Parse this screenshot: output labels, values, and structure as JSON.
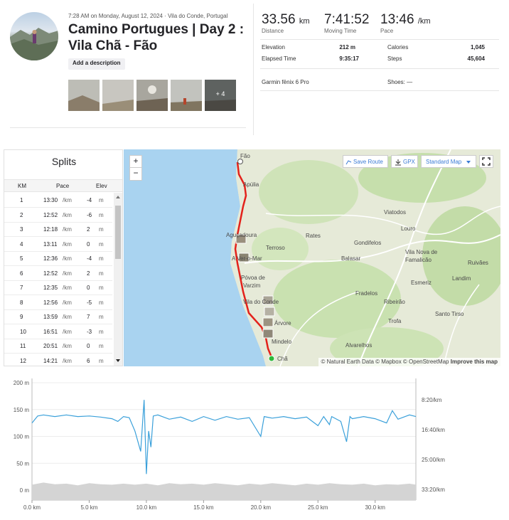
{
  "activity": {
    "meta": "7:28 AM on Monday, August 12, 2024 · Vila do Conde, Portugal",
    "title": "Camino Portugues | Day 2 : Vila Chã - Fão",
    "add_description": "Add a description",
    "more_photos": "+ 4"
  },
  "stats": {
    "distance": {
      "value": "33.56",
      "unit": "km",
      "label": "Distance"
    },
    "moving_time": {
      "value": "7:41:52",
      "label": "Moving Time"
    },
    "pace": {
      "value": "13:46",
      "unit": "/km",
      "label": "Pace"
    },
    "rows": [
      {
        "label": "Elevation",
        "value": "212 m",
        "label2": "Calories",
        "value2": "1,045"
      },
      {
        "label": "Elapsed Time",
        "value": "9:35:17",
        "label2": "Steps",
        "value2": "45,604"
      }
    ],
    "device": "Garmin fēnix 6 Pro",
    "shoes": "Shoes: —"
  },
  "splits": {
    "title": "Splits",
    "headers": {
      "km": "KM",
      "pace": "Pace",
      "elev": "Elev"
    },
    "rows": [
      {
        "km": "1",
        "pace": "13:30",
        "unit": "/km",
        "elev": "-4",
        "eu": "m"
      },
      {
        "km": "2",
        "pace": "12:52",
        "unit": "/km",
        "elev": "-6",
        "eu": "m"
      },
      {
        "km": "3",
        "pace": "12:18",
        "unit": "/km",
        "elev": "2",
        "eu": "m"
      },
      {
        "km": "4",
        "pace": "13:11",
        "unit": "/km",
        "elev": "0",
        "eu": "m"
      },
      {
        "km": "5",
        "pace": "12:36",
        "unit": "/km",
        "elev": "-4",
        "eu": "m"
      },
      {
        "km": "6",
        "pace": "12:52",
        "unit": "/km",
        "elev": "2",
        "eu": "m"
      },
      {
        "km": "7",
        "pace": "12:35",
        "unit": "/km",
        "elev": "0",
        "eu": "m"
      },
      {
        "km": "8",
        "pace": "12:56",
        "unit": "/km",
        "elev": "-5",
        "eu": "m"
      },
      {
        "km": "9",
        "pace": "13:59",
        "unit": "/km",
        "elev": "7",
        "eu": "m"
      },
      {
        "km": "10",
        "pace": "16:51",
        "unit": "/km",
        "elev": "-3",
        "eu": "m"
      },
      {
        "km": "11",
        "pace": "20:51",
        "unit": "/km",
        "elev": "0",
        "eu": "m"
      },
      {
        "km": "12",
        "pace": "14:21",
        "unit": "/km",
        "elev": "6",
        "eu": "m"
      }
    ]
  },
  "map": {
    "zoom_in": "+",
    "zoom_out": "−",
    "save_route": "Save Route",
    "gpx": "GPX",
    "map_style": "Standard Map",
    "attribution": "© Natural Earth Data © Mapbox © OpenStreetMap",
    "improve": "Improve this map",
    "places": {
      "fao": "Fão",
      "apulia": "Apúlia",
      "aguçadoura": "Aguçadoura",
      "amar": "A Ver-o-Mar",
      "povoa": "Póvoa de",
      "varzim": "Varzim",
      "viladoconde": "Vila do Conde",
      "avore": "Árvore",
      "mindelo": "Mindelo",
      "cha": "Chã",
      "rates": "Rates",
      "terroso": "Terroso",
      "viatodos": "Viatodos",
      "louro": "Louro",
      "gondifelos": "Gondifelos",
      "balasar": "Balasar",
      "vnf1": "Vila Nova de",
      "vnf2": "Famalicão",
      "ruivaes": "Ruivães",
      "landim": "Landim",
      "esmeriz": "Esmeriz",
      "fradelos": "Fradelos",
      "ribeirao": "Ribeirão",
      "santotirso": "Santo Tirso",
      "trofa": "Trofa",
      "alvarelhos": "Alvarelhos"
    }
  },
  "chart_data": {
    "type": "line",
    "left_axis": {
      "ticks": [
        "200 m",
        "150 m",
        "100 m",
        "50 m",
        "0 m"
      ],
      "values": [
        200,
        150,
        100,
        50,
        0
      ]
    },
    "right_axis": {
      "ticks": [
        "8:20/km",
        "16:40/km",
        "25:00/km",
        "33:20/km"
      ]
    },
    "x_axis": {
      "ticks": [
        "0.0 km",
        "5.0 km",
        "10.0 km",
        "15.0 km",
        "20.0 km",
        "25.0 km",
        "30.0 km"
      ],
      "values": [
        0,
        5,
        10,
        15,
        20,
        25,
        30
      ],
      "max": 33.56
    },
    "series": [
      {
        "type": "pace",
        "color": "#3aa0da",
        "points": [
          [
            0,
            125
          ],
          [
            0.5,
            138
          ],
          [
            1,
            140
          ],
          [
            2,
            137
          ],
          [
            3,
            140
          ],
          [
            4,
            137
          ],
          [
            5,
            138
          ],
          [
            6,
            136
          ],
          [
            7,
            133
          ],
          [
            7.5,
            128
          ],
          [
            8,
            137
          ],
          [
            8.5,
            135
          ],
          [
            9,
            110
          ],
          [
            9.5,
            72
          ],
          [
            9.8,
            168
          ],
          [
            10,
            30
          ],
          [
            10.2,
            110
          ],
          [
            10.4,
            80
          ],
          [
            10.6,
            138
          ],
          [
            11,
            140
          ],
          [
            12,
            132
          ],
          [
            13,
            136
          ],
          [
            14,
            128
          ],
          [
            15,
            137
          ],
          [
            16,
            130
          ],
          [
            17,
            137
          ],
          [
            18,
            132
          ],
          [
            19,
            135
          ],
          [
            20,
            100
          ],
          [
            20.3,
            137
          ],
          [
            21,
            134
          ],
          [
            22,
            137
          ],
          [
            23,
            133
          ],
          [
            24,
            136
          ],
          [
            25,
            120
          ],
          [
            25.5,
            137
          ],
          [
            26,
            122
          ],
          [
            26.2,
            137
          ],
          [
            27,
            128
          ],
          [
            27.5,
            90
          ],
          [
            27.8,
            137
          ],
          [
            28,
            133
          ],
          [
            29,
            137
          ],
          [
            30,
            133
          ],
          [
            31,
            125
          ],
          [
            31.5,
            148
          ],
          [
            32,
            132
          ],
          [
            33,
            140
          ],
          [
            33.56,
            137
          ]
        ]
      },
      {
        "type": "elevation",
        "color": "#d4d4d4",
        "points": [
          [
            0,
            10
          ],
          [
            1,
            14
          ],
          [
            2,
            11
          ],
          [
            3,
            12
          ],
          [
            4,
            9
          ],
          [
            5,
            13
          ],
          [
            6,
            11
          ],
          [
            7,
            10
          ],
          [
            8,
            12
          ],
          [
            9,
            10
          ],
          [
            10,
            12
          ],
          [
            11,
            9
          ],
          [
            12,
            13
          ],
          [
            13,
            11
          ],
          [
            14,
            12
          ],
          [
            15,
            10
          ],
          [
            16,
            13
          ],
          [
            17,
            11
          ],
          [
            18,
            9
          ],
          [
            19,
            12
          ],
          [
            20,
            10
          ],
          [
            21,
            13
          ],
          [
            22,
            11
          ],
          [
            23,
            9
          ],
          [
            24,
            12
          ],
          [
            25,
            10
          ],
          [
            26,
            13
          ],
          [
            27,
            11
          ],
          [
            28,
            10
          ],
          [
            29,
            12
          ],
          [
            30,
            9
          ],
          [
            31,
            11
          ],
          [
            32,
            10
          ],
          [
            33,
            12
          ],
          [
            33.56,
            10
          ]
        ]
      }
    ],
    "ylim": [
      0,
      200
    ]
  }
}
